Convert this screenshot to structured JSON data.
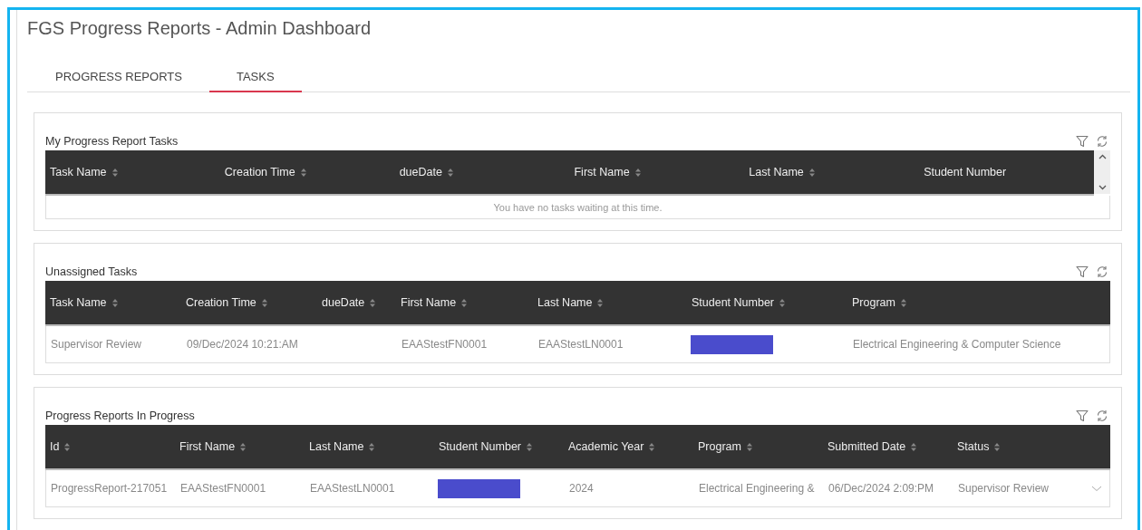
{
  "window": {
    "title": "FGS Progress Reports - Admin Dashboard"
  },
  "tabs": [
    {
      "label": "PROGRESS REPORTS",
      "selected": false
    },
    {
      "label": "TASKS",
      "selected": true
    }
  ],
  "panels": [
    {
      "title": "My Progress Report Tasks",
      "scrollable": true,
      "columns": [
        {
          "label": "Task Name",
          "sortable": true
        },
        {
          "label": "Creation Time",
          "sortable": true
        },
        {
          "label": "dueDate",
          "sortable": true
        },
        {
          "label": "First Name",
          "sortable": true
        },
        {
          "label": "Last Name",
          "sortable": true
        },
        {
          "label": "Student Number",
          "sortable": false
        }
      ],
      "empty_message": "You have no tasks waiting at this time."
    },
    {
      "title": "Unassigned Tasks",
      "scrollable": false,
      "columns": [
        {
          "label": "Task Name",
          "sortable": true
        },
        {
          "label": "Creation Time",
          "sortable": true
        },
        {
          "label": "dueDate",
          "sortable": true
        },
        {
          "label": "First Name",
          "sortable": true
        },
        {
          "label": "Last Name",
          "sortable": true
        },
        {
          "label": "Student Number",
          "sortable": true
        },
        {
          "label": "Program",
          "sortable": true
        }
      ],
      "rows": [
        {
          "cells": [
            "Supervisor Review",
            "09/Dec/2024 10:21:AM",
            "",
            "EAAStestFN0001",
            "EAAStestLN0001",
            {
              "kind": "redacted"
            },
            "Electrical Engineering & Computer Science"
          ]
        }
      ]
    },
    {
      "title": "Progress Reports In Progress",
      "scrollable": false,
      "columns": [
        {
          "label": "Id",
          "sortable": true
        },
        {
          "label": "First Name",
          "sortable": true
        },
        {
          "label": "Last Name",
          "sortable": true
        },
        {
          "label": "Student Number",
          "sortable": true
        },
        {
          "label": "Academic Year",
          "sortable": true
        },
        {
          "label": "Program",
          "sortable": true
        },
        {
          "label": "Submitted Date",
          "sortable": true
        },
        {
          "label": "Status",
          "sortable": true
        }
      ],
      "rows": [
        {
          "cells": [
            "ProgressReport-217051",
            "EAAStestFN0001",
            "EAAStestLN0001",
            {
              "kind": "redacted"
            },
            "2024",
            "Electrical Engineering &",
            "06/Dec/2024 2:09:PM",
            "Supervisor Review"
          ],
          "expanded": false
        }
      ]
    }
  ]
}
